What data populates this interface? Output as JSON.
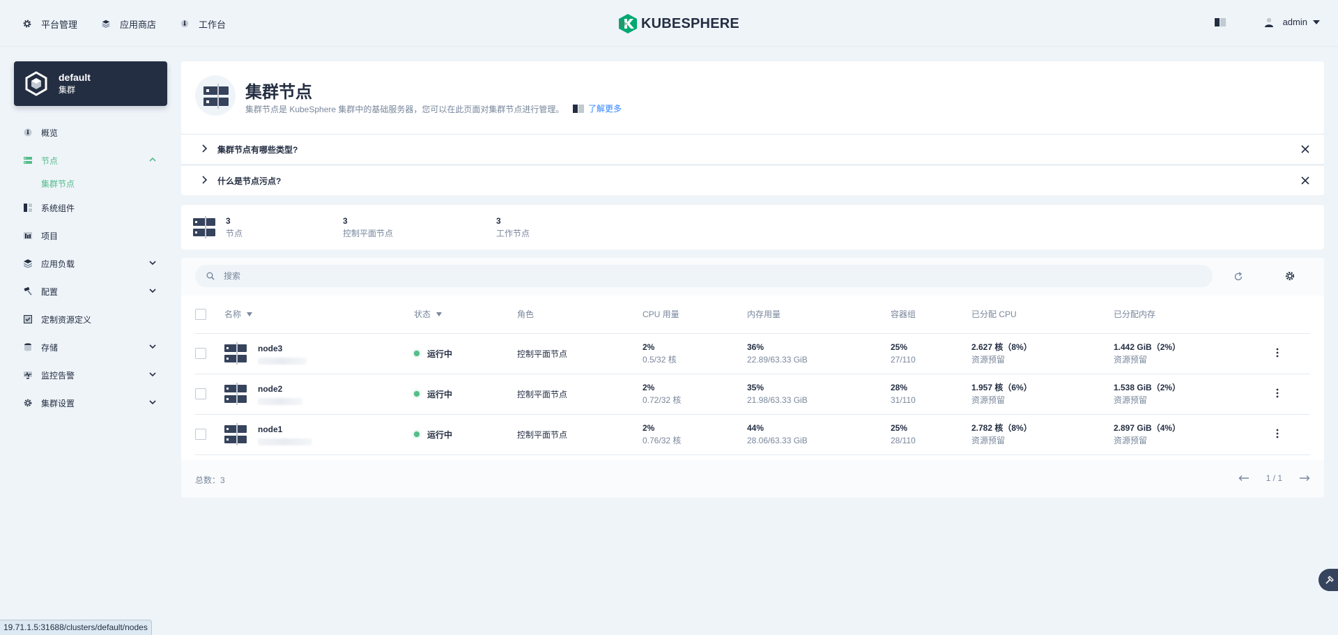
{
  "topnav": {
    "items": [
      {
        "label": "平台管理",
        "icon": "gear-icon"
      },
      {
        "label": "应用商店",
        "icon": "layers-icon"
      },
      {
        "label": "工作台",
        "icon": "dashboard-icon"
      }
    ],
    "logo_text": "KUBESPHERE",
    "user": "admin"
  },
  "cluster": {
    "name": "default",
    "type": "集群"
  },
  "sidebar": {
    "items": [
      {
        "label": "概览",
        "icon": "dashboard-icon"
      },
      {
        "label": "节点",
        "icon": "server-icon",
        "active": true,
        "expanded": true
      },
      {
        "label": "集群节点",
        "sub": true
      },
      {
        "label": "系统组件",
        "icon": "components-icon"
      },
      {
        "label": "项目",
        "icon": "project-icon"
      },
      {
        "label": "应用负载",
        "icon": "layers-icon"
      },
      {
        "label": "配置",
        "icon": "hammer-icon"
      },
      {
        "label": "定制资源定义",
        "icon": "crd-icon"
      },
      {
        "label": "存储",
        "icon": "database-icon"
      },
      {
        "label": "监控告警",
        "icon": "monitor-icon"
      },
      {
        "label": "集群设置",
        "icon": "gear-icon"
      }
    ]
  },
  "header": {
    "title": "集群节点",
    "description": "集群节点是 KubeSphere 集群中的基础服务器，您可以在此页面对集群节点进行管理。",
    "learn_more": "了解更多"
  },
  "faq": [
    {
      "question": "集群节点有哪些类型?"
    },
    {
      "question": "什么是节点污点?"
    }
  ],
  "stats": [
    {
      "value": "3",
      "label": "节点"
    },
    {
      "value": "3",
      "label": "控制平面节点"
    },
    {
      "value": "3",
      "label": "工作节点"
    }
  ],
  "search": {
    "placeholder": "搜索"
  },
  "table": {
    "columns": [
      "名称",
      "状态",
      "角色",
      "CPU 用量",
      "内存用量",
      "容器组",
      "已分配 CPU",
      "已分配内存"
    ],
    "rows": [
      {
        "name": "node3",
        "status": "运行中",
        "role": "控制平面节点",
        "cpu_pct": "2%",
        "cpu_detail": "0.5/32 核",
        "mem_pct": "36%",
        "mem_detail": "22.89/63.33 GiB",
        "pods_pct": "25%",
        "pods_detail": "27/110",
        "alloc_cpu": "2.627 核（8%）",
        "alloc_cpu_label": "资源预留",
        "alloc_mem": "1.442 GiB（2%）",
        "alloc_mem_label": "资源预留"
      },
      {
        "name": "node2",
        "status": "运行中",
        "role": "控制平面节点",
        "cpu_pct": "2%",
        "cpu_detail": "0.72/32 核",
        "mem_pct": "35%",
        "mem_detail": "21.98/63.33 GiB",
        "pods_pct": "28%",
        "pods_detail": "31/110",
        "alloc_cpu": "1.957 核（6%）",
        "alloc_cpu_label": "资源预留",
        "alloc_mem": "1.538 GiB（2%）",
        "alloc_mem_label": "资源预留"
      },
      {
        "name": "node1",
        "status": "运行中",
        "role": "控制平面节点",
        "cpu_pct": "2%",
        "cpu_detail": "0.76/32 核",
        "mem_pct": "44%",
        "mem_detail": "28.06/63.33 GiB",
        "pods_pct": "25%",
        "pods_detail": "28/110",
        "alloc_cpu": "2.782 核（8%）",
        "alloc_cpu_label": "资源预留",
        "alloc_mem": "2.897 GiB（4%）",
        "alloc_mem_label": "资源预留"
      }
    ],
    "total": "总数：3",
    "page": "1 / 1"
  },
  "statusbar": "19.71.1.5:31688/clusters/default/nodes",
  "colors": {
    "accent": "#55bc8a",
    "dark": "#242e42",
    "link": "#3385ff",
    "muted": "#79879c"
  }
}
